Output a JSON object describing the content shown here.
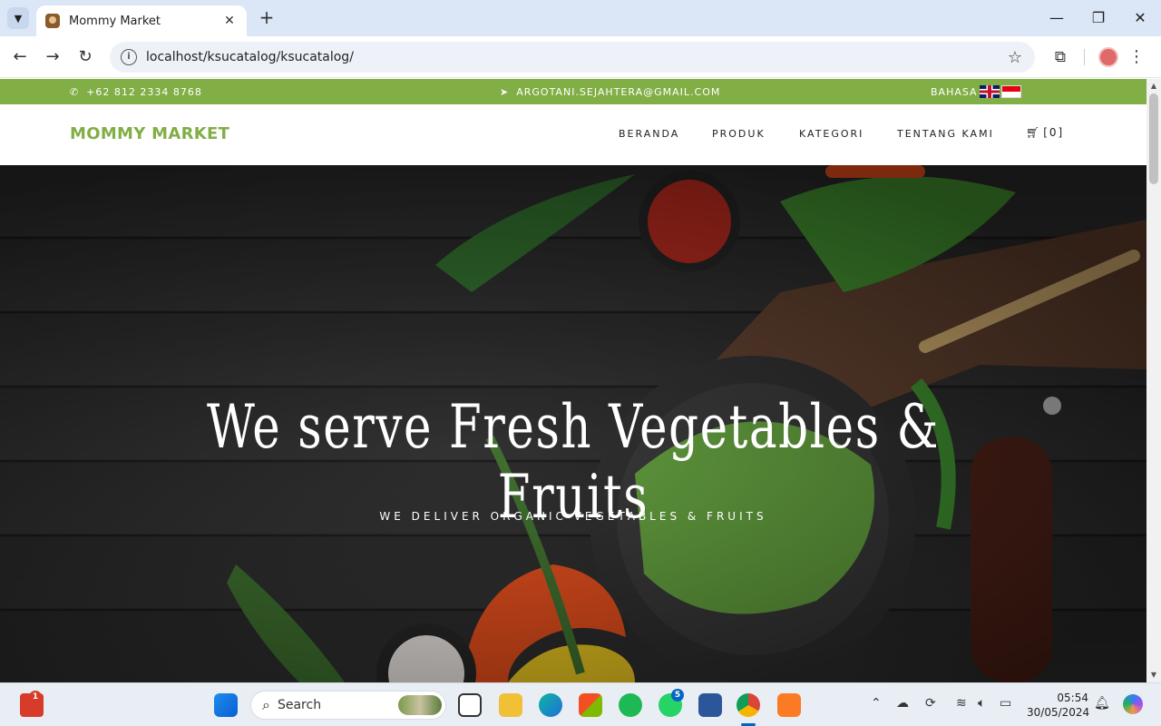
{
  "browser": {
    "tab_title": "Mommy Market",
    "tab_close": "✕",
    "new_tab": "+",
    "url": "localhost/ksucatalog/ksucatalog/",
    "window_controls": {
      "minimize": "—",
      "maximize": "❐",
      "close": "✕"
    }
  },
  "site": {
    "topbar": {
      "phone": "+62 812 2334 8768",
      "email": "ARGOTANI.SEJAHTERA@GMAIL.COM",
      "language_label": "BAHASA"
    },
    "brand": "MOMMY MARKET",
    "menu": [
      "BERANDA",
      "PRODUK",
      "KATEGORI",
      "TENTANG KAMI"
    ],
    "cart_label": "[0]",
    "hero": {
      "title": "We serve Fresh Vegetables & Fruits",
      "subtitle": "WE DELIVER ORGANIC VEGETABLES & FRUITS"
    },
    "colors": {
      "accent": "#82ae46"
    }
  },
  "taskbar": {
    "search_placeholder": "Search",
    "notification_badge": "1",
    "whatsapp_badge": "5",
    "time": "05:54",
    "date": "30/05/2024"
  }
}
